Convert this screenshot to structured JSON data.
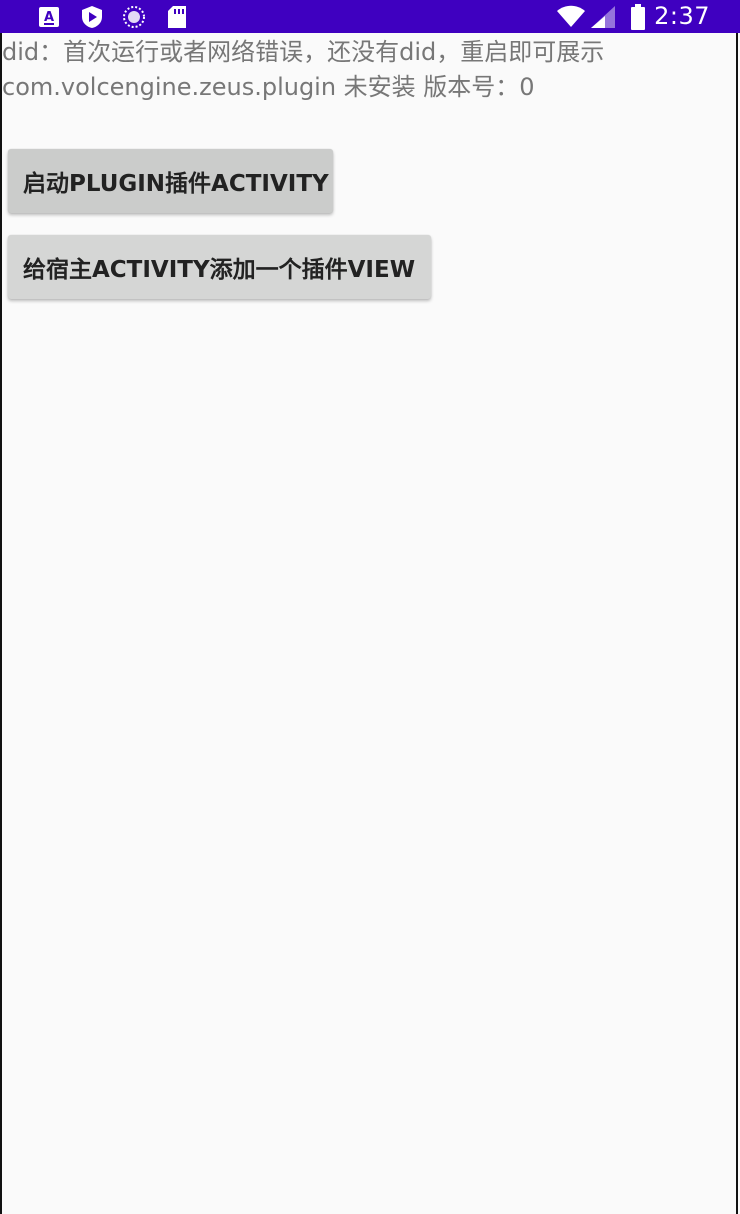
{
  "status_bar": {
    "time": "2:37",
    "background": "#3f00c0",
    "left_icons": [
      "keyboard-a-icon",
      "play-shield-icon",
      "sync-circle-icon",
      "sd-card-icon"
    ],
    "right_icons": [
      "wifi-icon",
      "cellular-signal-icon",
      "battery-icon"
    ]
  },
  "info": {
    "did_text": "did：首次运行或者网络错误，还没有did，重启即可展示",
    "plugin_text": "com.volcengine.zeus.plugin 未安装  版本号：0"
  },
  "buttons": {
    "launch_plugin_activity": "启动PLUGIN插件ACTIVITY",
    "add_plugin_view": "给宿主ACTIVITY添加一个插件VIEW"
  }
}
